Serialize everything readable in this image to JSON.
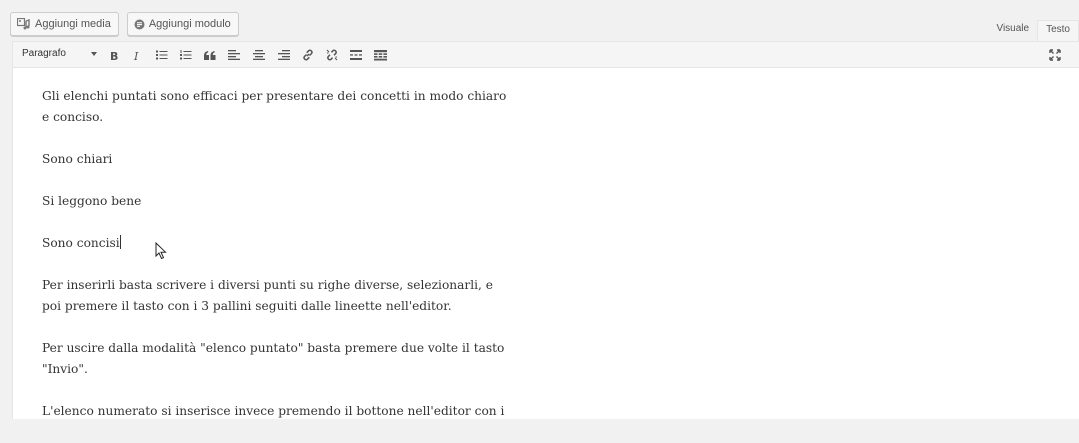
{
  "media_buttons": [
    {
      "label": "Aggiungi media",
      "icon": "media-icon"
    },
    {
      "label": "Aggiungi modulo",
      "icon": "form-icon"
    }
  ],
  "mode_tabs": [
    {
      "label": "Visuale",
      "active": true
    },
    {
      "label": "Testo",
      "active": false
    }
  ],
  "toolbar": {
    "format_value": "Paragrafo",
    "buttons": [
      {
        "name": "bold",
        "icon": "bold-icon"
      },
      {
        "name": "italic",
        "icon": "italic-icon"
      },
      {
        "name": "bulleted-list",
        "icon": "bulleted-list-icon"
      },
      {
        "name": "numbered-list",
        "icon": "numbered-list-icon"
      },
      {
        "name": "blockquote",
        "icon": "blockquote-icon"
      },
      {
        "name": "align-left",
        "icon": "align-left-icon"
      },
      {
        "name": "align-center",
        "icon": "align-center-icon"
      },
      {
        "name": "align-right",
        "icon": "align-right-icon"
      },
      {
        "name": "insert-link",
        "icon": "link-icon"
      },
      {
        "name": "remove-link",
        "icon": "unlink-icon"
      },
      {
        "name": "read-more",
        "icon": "read-more-icon"
      },
      {
        "name": "toolbar-toggle",
        "icon": "kitchen-sink-icon"
      },
      {
        "name": "fullscreen",
        "icon": "fullscreen-icon"
      }
    ]
  },
  "content": {
    "paragraphs": [
      "Gli elenchi puntati sono efficaci per presentare dei concetti in modo chiaro e conciso.",
      "Sono chiari",
      "Si leggono bene",
      "Sono concisi",
      "Per inserirli basta scrivere i diversi punti su righe diverse, selezionarli, e poi premere il tasto con i 3 pallini seguiti dalle lineette nell'editor.",
      "Per uscire dalla modalità \"elenco puntato\" basta premere due volte il tasto \"Invio\".",
      "L'elenco numerato si inserisce invece premendo il bottone nell'editor con i"
    ]
  },
  "colors": {
    "background": "#f1f1f1",
    "editor": "#ffffff",
    "text": "#333333"
  }
}
